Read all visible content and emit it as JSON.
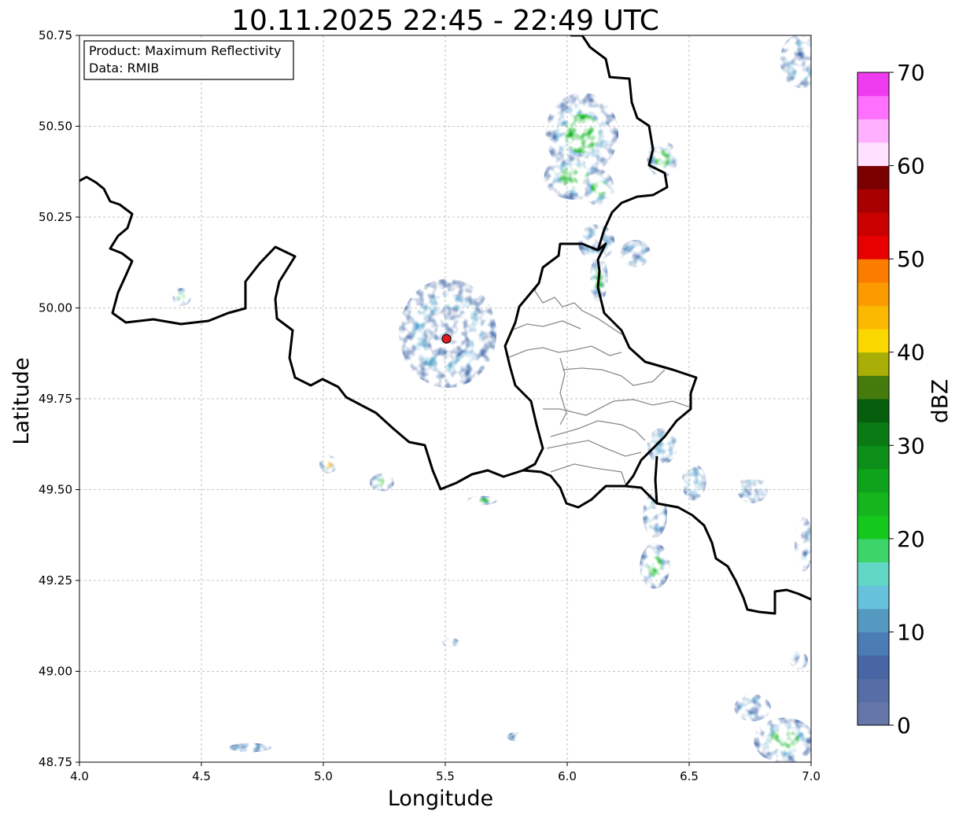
{
  "title": "10.11.2025 22:45 - 22:49 UTC",
  "info_box": {
    "product": "Product: Maximum Reflectivity",
    "source": "Data: RMIB"
  },
  "axes": {
    "xlabel": "Longitude",
    "ylabel": "Latitude",
    "xlim": [
      4.0,
      7.0
    ],
    "ylim": [
      48.75,
      50.75
    ],
    "xticks": [
      "4.0",
      "4.5",
      "5.0",
      "5.5",
      "6.0",
      "6.5",
      "7.0"
    ],
    "yticks": [
      "50.75",
      "50.50",
      "50.25",
      "50.00",
      "49.75",
      "49.50",
      "49.25",
      "49.00",
      "48.75"
    ],
    "grid": true
  },
  "colorbar": {
    "label": "dBZ",
    "ticks": [
      "0",
      "10",
      "20",
      "30",
      "40",
      "50",
      "60",
      "70"
    ],
    "range": [
      0,
      70
    ],
    "colors": [
      "#6577a8",
      "#566ea5",
      "#4866a3",
      "#4b7cb3",
      "#5599c0",
      "#66c2da",
      "#63d7c6",
      "#3dd46a",
      "#14c81e",
      "#15b51e",
      "#0fa21b",
      "#0c8f18",
      "#0a7a14",
      "#065f0d",
      "#457b0c",
      "#a8ae05",
      "#fbd700",
      "#fbb800",
      "#fc9b00",
      "#fc7c00",
      "#e60000",
      "#c80000",
      "#a80000",
      "#7a0000",
      "#ffe0ff",
      "#ffb0ff",
      "#ff70ff",
      "#f03cf0"
    ]
  },
  "radar_site": {
    "lon": 5.505,
    "lat": 49.915,
    "color": "#e31a1c"
  },
  "echo_colors": {
    "weak": "#4a70ad",
    "light": "#5ea8cf",
    "medium": "#18b82a",
    "strong": "#0a7d12",
    "intense": "#f8a400"
  },
  "echoes": [
    {
      "lon": 6.06,
      "lat": 50.48,
      "rx": 0.12,
      "ry": 0.09,
      "level": "medium"
    },
    {
      "lon": 6.03,
      "lat": 50.36,
      "rx": 0.1,
      "ry": 0.05,
      "level": "medium"
    },
    {
      "lon": 6.13,
      "lat": 50.33,
      "rx": 0.05,
      "ry": 0.04,
      "level": "medium"
    },
    {
      "lon": 6.39,
      "lat": 50.41,
      "rx": 0.05,
      "ry": 0.04,
      "level": "medium"
    },
    {
      "lon": 6.36,
      "lat": 49.29,
      "rx": 0.05,
      "ry": 0.05,
      "level": "medium"
    },
    {
      "lon": 6.52,
      "lat": 49.52,
      "rx": 0.04,
      "ry": 0.04,
      "level": "light"
    },
    {
      "lon": 6.39,
      "lat": 49.62,
      "rx": 0.05,
      "ry": 0.04,
      "level": "light"
    },
    {
      "lon": 6.89,
      "lat": 48.81,
      "rx": 0.1,
      "ry": 0.05,
      "level": "medium"
    },
    {
      "lon": 4.42,
      "lat": 50.03,
      "rx": 0.03,
      "ry": 0.02,
      "level": "medium"
    },
    {
      "lon": 5.02,
      "lat": 49.57,
      "rx": 0.03,
      "ry": 0.02,
      "level": "intense"
    },
    {
      "lon": 4.7,
      "lat": 48.79,
      "rx": 0.07,
      "ry": 0.01,
      "level": "weak"
    },
    {
      "lon": 6.96,
      "lat": 50.68,
      "rx": 0.07,
      "ry": 0.06,
      "level": "weak"
    },
    {
      "lon": 6.12,
      "lat": 50.18,
      "rx": 0.06,
      "ry": 0.04,
      "level": "weak"
    },
    {
      "lon": 6.28,
      "lat": 50.15,
      "rx": 0.05,
      "ry": 0.03,
      "level": "weak"
    },
    {
      "lon": 6.76,
      "lat": 48.9,
      "rx": 0.06,
      "ry": 0.03,
      "level": "weak"
    },
    {
      "lon": 6.36,
      "lat": 49.43,
      "rx": 0.04,
      "ry": 0.05,
      "level": "weak"
    },
    {
      "lon": 6.97,
      "lat": 49.35,
      "rx": 0.03,
      "ry": 0.06,
      "level": "weak"
    },
    {
      "lon": 6.76,
      "lat": 49.5,
      "rx": 0.05,
      "ry": 0.03,
      "level": "weak"
    },
    {
      "lon": 5.65,
      "lat": 49.47,
      "rx": 0.05,
      "ry": 0.01,
      "level": "medium"
    },
    {
      "lon": 5.24,
      "lat": 49.52,
      "rx": 0.04,
      "ry": 0.02,
      "level": "medium"
    },
    {
      "lon": 5.52,
      "lat": 49.08,
      "rx": 0.03,
      "ry": 0.01,
      "level": "weak"
    },
    {
      "lon": 6.95,
      "lat": 49.03,
      "rx": 0.03,
      "ry": 0.02,
      "level": "weak"
    },
    {
      "lon": 5.79,
      "lat": 48.82,
      "rx": 0.03,
      "ry": 0.01,
      "level": "weak"
    },
    {
      "lon": 5.51,
      "lat": 49.93,
      "rx": 0.16,
      "ry": 0.12,
      "level": "weak"
    },
    {
      "lon": 6.13,
      "lat": 50.08,
      "rx": 0.03,
      "ry": 0.05,
      "level": "medium"
    }
  ]
}
